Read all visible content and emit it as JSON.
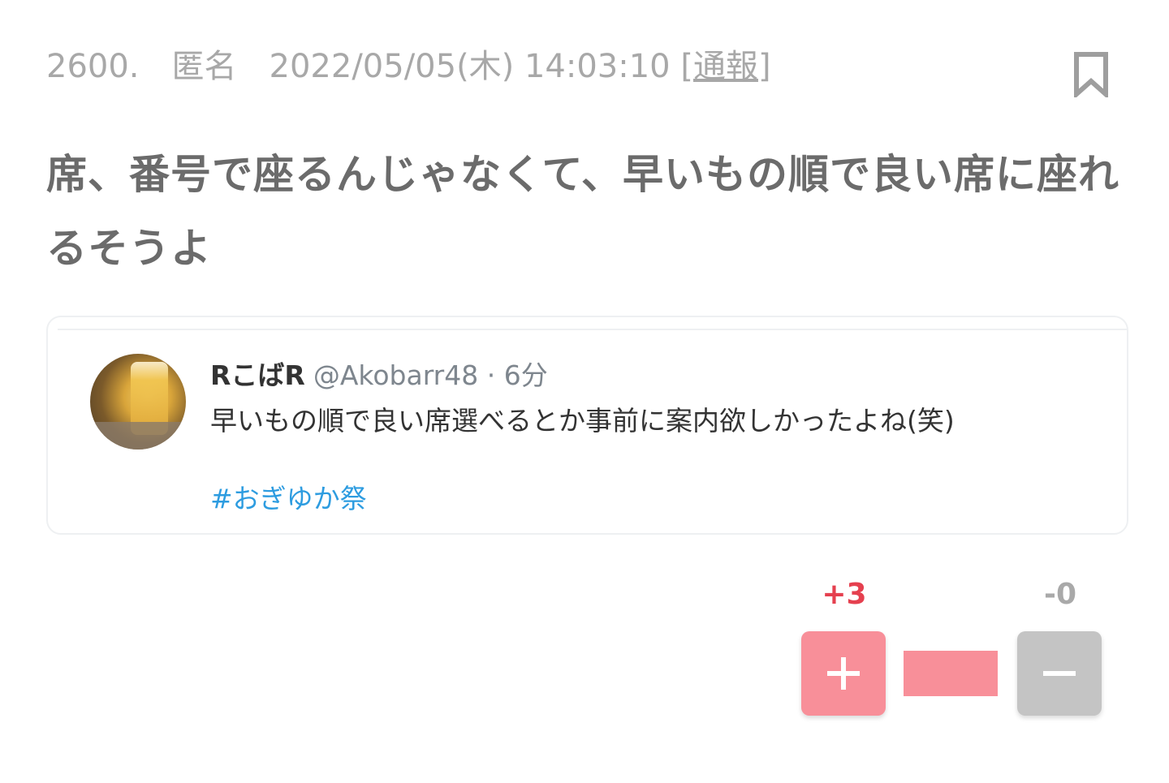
{
  "comment": {
    "number": "2600.",
    "author": "匿名",
    "datetime": "2022/05/05(木) 14:03:10",
    "report_open": "[",
    "report_label": "通報",
    "report_close": "]",
    "body": "席、番号で座るんじゃなくて、早いもの順で良い席に座れるそうよ"
  },
  "tweet": {
    "user_name": "RこばR",
    "handle_time": "@Akobarr48 · 6分",
    "text": "早いもの順で良い席選べるとか事前に案内欲しかったよね(笑)",
    "hashtag": "#おぎゆか祭"
  },
  "votes": {
    "plus_count": "+3",
    "minus_count": "-0",
    "plus_ratio": 1.0
  },
  "icons": {
    "bookmark": "bookmark-icon",
    "plus": "plus-icon",
    "minus": "minus-icon"
  },
  "colors": {
    "plus": "#f88f99",
    "plus_text": "#e5404f",
    "minus": "#c4c4c4",
    "hashtag": "#2d9ce0",
    "meta": "#a8a8a8",
    "body": "#6b6b6b"
  }
}
